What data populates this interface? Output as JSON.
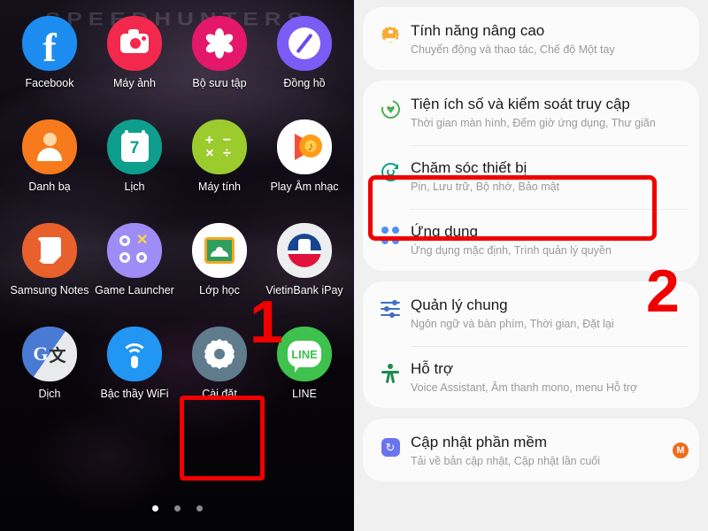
{
  "home_screen": {
    "wallpaper_text": "SPEEDHUNTERS",
    "apps": [
      {
        "label": "Facebook",
        "icon": "facebook-icon"
      },
      {
        "label": "Máy ảnh",
        "icon": "camera-icon"
      },
      {
        "label": "Bộ sưu tập",
        "icon": "gallery-icon"
      },
      {
        "label": "Đồng hồ",
        "icon": "clock-icon"
      },
      {
        "label": "Danh bạ",
        "icon": "contacts-icon"
      },
      {
        "label": "Lịch",
        "icon": "calendar-icon"
      },
      {
        "label": "Máy tính",
        "icon": "calculator-icon"
      },
      {
        "label": "Play Âm nhạc",
        "icon": "play-music-icon"
      },
      {
        "label": "Samsung Notes",
        "icon": "samsung-notes-icon"
      },
      {
        "label": "Game Launcher",
        "icon": "game-launcher-icon"
      },
      {
        "label": "Lớp học",
        "icon": "google-classroom-icon"
      },
      {
        "label": "VietinBank iPay",
        "icon": "vietinbank-ipay-icon"
      },
      {
        "label": "Dịch",
        "icon": "google-translate-icon"
      },
      {
        "label": "Bậc thầy WiFi",
        "icon": "wifi-master-icon"
      },
      {
        "label": "Cài đặt",
        "icon": "settings-gear-icon"
      },
      {
        "label": "LINE",
        "icon": "line-icon"
      }
    ],
    "calendar_day": "7",
    "calculator_symbols": "+ −\n× ÷",
    "translate_letter": "G",
    "line_text": "LINE",
    "page_indicator": {
      "total": 3,
      "active": 1
    }
  },
  "annotations": {
    "step_one": "1",
    "step_two": "2",
    "highlight_color": "#f10000"
  },
  "settings": {
    "groups": [
      {
        "items": [
          {
            "title": "Tính năng nâng cao",
            "subtitle": "Chuyển động và thao tác, Chế độ Một tay",
            "icon": "advanced-features-gear-icon",
            "badge": ""
          }
        ]
      },
      {
        "items": [
          {
            "title": "Tiện ích số và kiểm soát truy cập",
            "subtitle": "Thời gian màn hình, Đếm giờ ứng dụng, Thư giãn",
            "icon": "digital-wellbeing-icon",
            "badge": ""
          },
          {
            "title": "Chăm sóc thiết bị",
            "subtitle": "Pin, Lưu trữ, Bộ nhớ, Bảo mật",
            "icon": "device-care-icon",
            "badge": ""
          },
          {
            "title": "Ứng dụng",
            "subtitle": "Ứng dụng mặc định, Trình quản lý quyền",
            "icon": "apps-grid-icon",
            "badge": ""
          }
        ]
      },
      {
        "items": [
          {
            "title": "Quản lý chung",
            "subtitle": "Ngôn ngữ và bàn phím, Thời gian, Đặt lại",
            "icon": "general-management-sliders-icon",
            "badge": ""
          },
          {
            "title": "Hỗ trợ",
            "subtitle": "Voice Assistant, Âm thanh mono, menu Hỗ trợ",
            "icon": "accessibility-icon",
            "badge": ""
          }
        ]
      },
      {
        "items": [
          {
            "title": "Cập nhật phần mềm",
            "subtitle": "Tải về bản cập nhật, Cập nhật lần cuối",
            "icon": "software-update-icon",
            "badge": "M"
          }
        ]
      }
    ]
  }
}
